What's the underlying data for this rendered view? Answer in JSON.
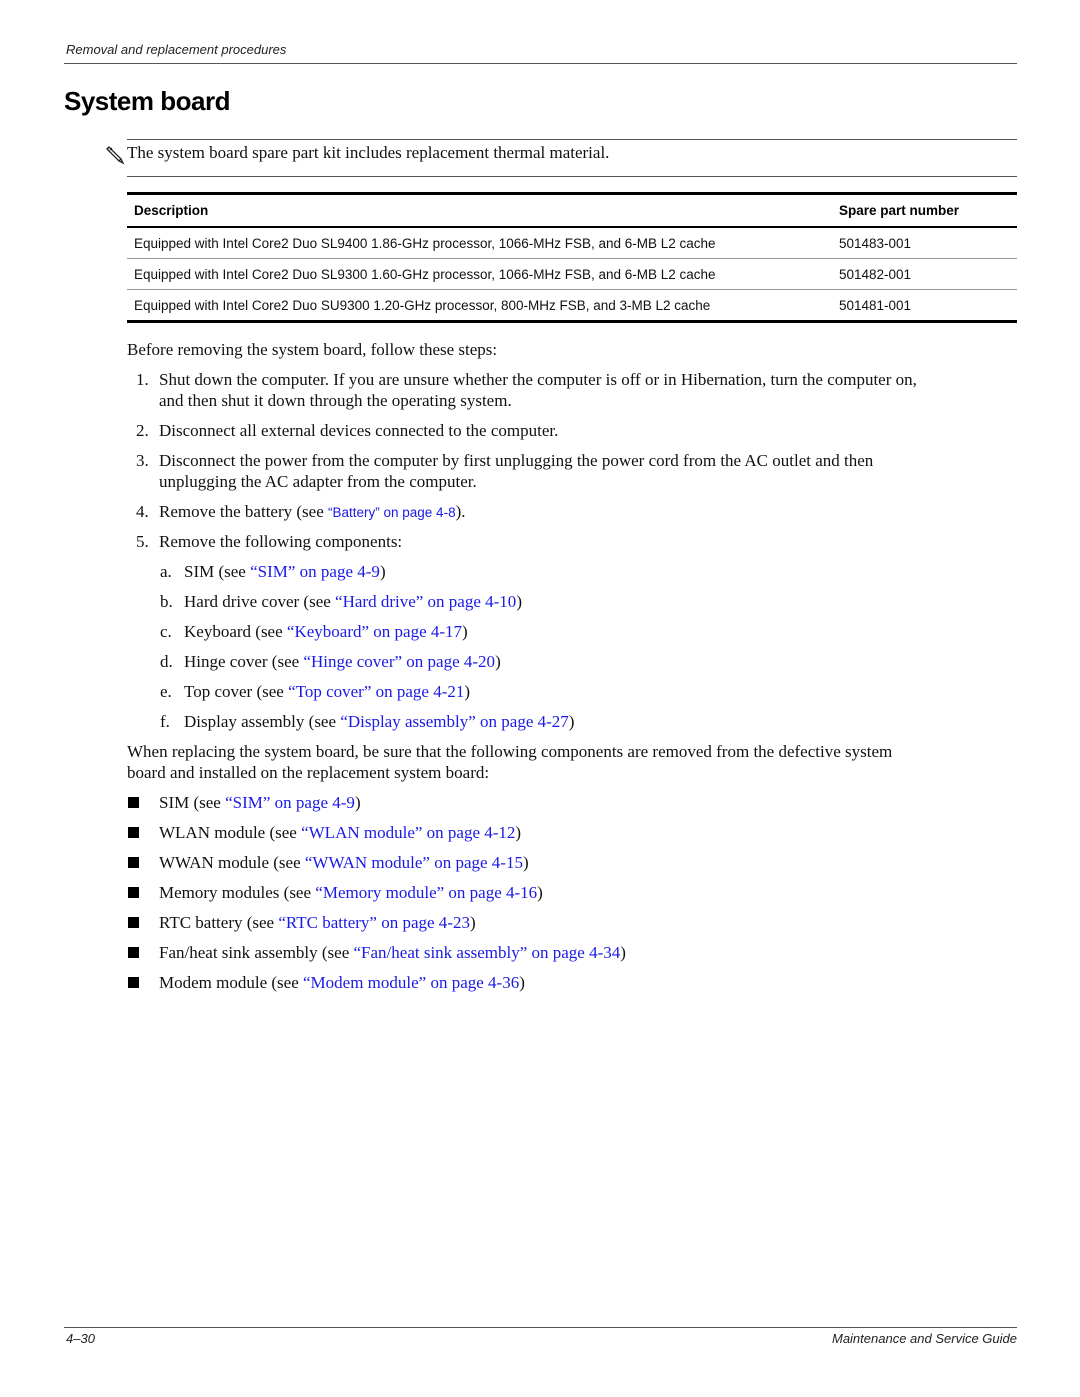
{
  "header": {
    "running_title": "Removal and replacement procedures"
  },
  "page_title": "System board",
  "note": {
    "icon": "pencil-note-icon",
    "text": "The system board spare part kit includes replacement thermal material."
  },
  "table": {
    "columns": [
      "Description",
      "Spare part number"
    ],
    "rows": [
      {
        "description": "Equipped with Intel Core2 Duo SL9400 1.86-GHz processor, 1066-MHz FSB, and 6-MB L2 cache",
        "part": "501483-001"
      },
      {
        "description": "Equipped with Intel Core2 Duo SL9300 1.60-GHz processor, 1066-MHz FSB, and 6-MB L2 cache",
        "part": "501482-001"
      },
      {
        "description": "Equipped with Intel Core2 Duo SU9300 1.20-GHz processor, 800-MHz FSB, and 3-MB L2 cache",
        "part": "501481-001"
      }
    ]
  },
  "intro": "Before removing the system board, follow these steps:",
  "steps": [
    {
      "num": "1.",
      "line1": "Shut down the computer. If you are unsure whether the computer is off or in Hibernation, turn the computer on,",
      "line2": "and then shut it down through the operating system."
    },
    {
      "num": "2.",
      "text": "Disconnect all external devices connected to the computer."
    },
    {
      "num": "3.",
      "line1": "Disconnect the power from the computer by first unplugging the power cord from the AC outlet and then",
      "line2": "unplugging the AC adapter from the computer."
    },
    {
      "num": "4.",
      "pre": "Remove the battery (see ",
      "link": "“Battery” on page 4-8",
      "post": ")."
    },
    {
      "num": "5.",
      "text": "Remove the following components:"
    }
  ],
  "substeps": [
    {
      "letter": "a.",
      "pre": "SIM (see ",
      "link": "“SIM” on page 4-9",
      "post": ")"
    },
    {
      "letter": "b.",
      "pre": "Hard drive cover (see ",
      "link": "“Hard drive” on page 4-10",
      "post": ")"
    },
    {
      "letter": "c.",
      "pre": "Keyboard (see ",
      "link": "“Keyboard” on page 4-17",
      "post": ")"
    },
    {
      "letter": "d.",
      "pre": "Hinge cover (see ",
      "link": "“Hinge cover” on page 4-20",
      "post": ")"
    },
    {
      "letter": "e.",
      "pre": "Top cover (see ",
      "link": "“Top cover” on page 4-21",
      "post": ")"
    },
    {
      "letter": "f.",
      "pre": "Display assembly (see ",
      "link": "“Display assembly” on page 4-27",
      "post": ")"
    }
  ],
  "replace_intro": {
    "line1": "When replacing the system board, be sure that the following components are removed from the defective system",
    "line2": "board and installed on the replacement system board:"
  },
  "bullets": [
    {
      "pre": "SIM (see ",
      "link": "“SIM” on page 4-9",
      "post": ")"
    },
    {
      "pre": "WLAN module (see ",
      "link": "“WLAN module” on page 4-12",
      "post": ")"
    },
    {
      "pre": "WWAN module (see ",
      "link": "“WWAN module” on page 4-15",
      "post": ")"
    },
    {
      "pre": "Memory modules (see ",
      "link": "“Memory module” on page 4-16",
      "post": ")"
    },
    {
      "pre": "RTC battery (see ",
      "link": "“RTC battery” on page 4-23",
      "post": ")"
    },
    {
      "pre": "Fan/heat sink assembly (see ",
      "link": "“Fan/heat sink assembly” on page 4-34",
      "post": ")"
    },
    {
      "pre": "Modem module (see ",
      "link": "“Modem module” on page 4-36",
      "post": ")"
    }
  ],
  "footer": {
    "page_number": "4–30",
    "guide_title": "Maintenance and Service Guide"
  },
  "colors": {
    "link": "#1a1ae6",
    "text": "#111111"
  }
}
